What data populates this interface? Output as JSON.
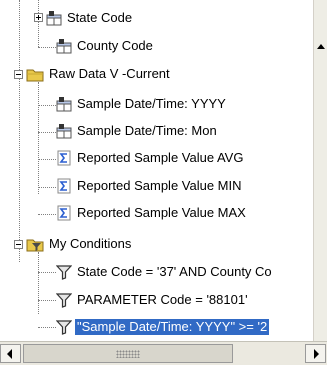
{
  "tree": {
    "items": [
      {
        "label": "State Code",
        "icon": "table-column-icon"
      },
      {
        "label": "County Code",
        "icon": "table-column-icon"
      },
      {
        "label": "Raw Data V -Current",
        "icon": "folder-icon"
      },
      {
        "label": "Sample Date/Time: YYYY",
        "icon": "table-column-icon"
      },
      {
        "label": "Sample Date/Time: Mon",
        "icon": "table-column-icon"
      },
      {
        "label": "Reported Sample Value AVG",
        "icon": "sigma-measure-icon"
      },
      {
        "label": "Reported Sample Value MIN",
        "icon": "sigma-measure-icon"
      },
      {
        "label": "Reported Sample Value MAX",
        "icon": "sigma-measure-icon"
      },
      {
        "label": "My Conditions",
        "icon": "filter-folder-icon"
      },
      {
        "label": "State Code = '37' AND County Co",
        "icon": "filter-icon"
      },
      {
        "label": "PARAMETER Code = '88101'",
        "icon": "filter-icon"
      },
      {
        "label": "\"Sample Date/Time: YYYY\" >= '2",
        "icon": "filter-icon",
        "selected": true
      }
    ]
  },
  "colors": {
    "selection": "#316ac5",
    "folder": "#e8c84a",
    "sigma": "#2b5fd0",
    "filter": "#4a4a4a"
  }
}
